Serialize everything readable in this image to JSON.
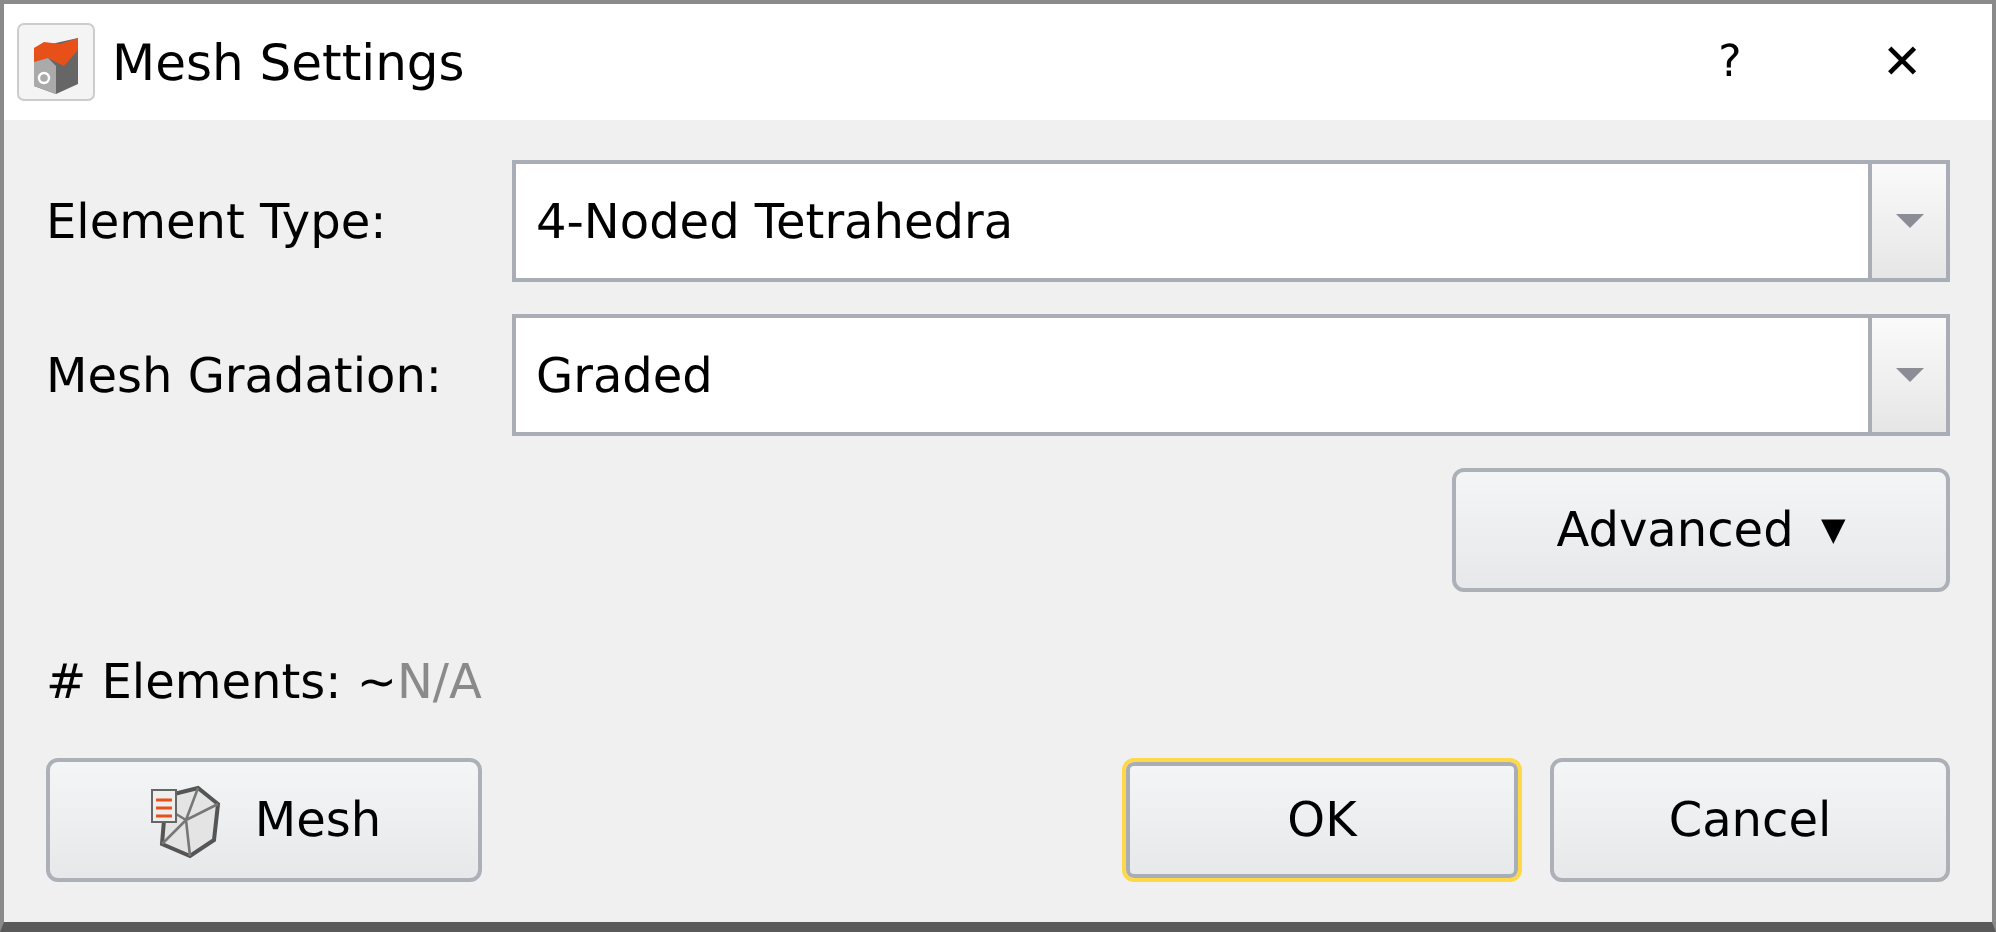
{
  "window": {
    "title": "Mesh Settings",
    "help": "?",
    "close": "✕"
  },
  "fields": [
    {
      "label": "Element Type:",
      "value": "4-Noded Tetrahedra"
    },
    {
      "label": "Mesh Gradation:",
      "value": "Graded"
    }
  ],
  "advanced_button": {
    "label": "Advanced",
    "caret": "▼"
  },
  "elements_count": {
    "label": "# Elements: ~",
    "value": "N/A"
  },
  "buttons": [
    {
      "kind": "mesh",
      "label": "Mesh",
      "focused": false
    },
    {
      "kind": "ok",
      "label": "OK",
      "focused": true
    },
    {
      "kind": "cancel",
      "label": "Cancel",
      "focused": false
    }
  ]
}
